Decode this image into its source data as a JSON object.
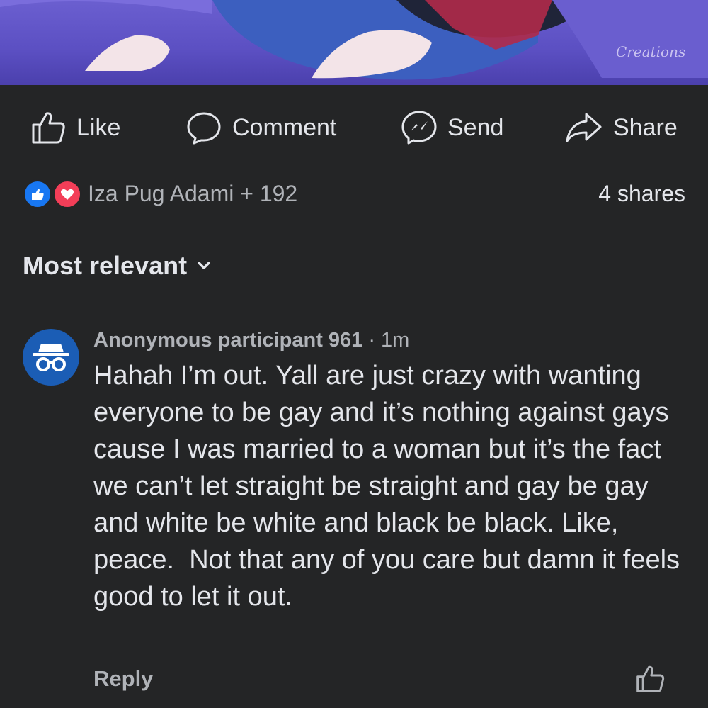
{
  "media": {
    "watermark": "Creations"
  },
  "actions": {
    "like": "Like",
    "comment": "Comment",
    "send": "Send",
    "share": "Share"
  },
  "reactions": {
    "names": "Iza Pug Adami + 192",
    "shares": "4 shares"
  },
  "sort": {
    "label": "Most relevant"
  },
  "comment": {
    "author": "Anonymous participant 961",
    "time": "1m",
    "text": "Hahah I’m out. Yall are just crazy with wanting everyone to be gay and it’s nothing against gays cause I was married to a woman but it’s the fact we can’t let straight be straight and gay be gay and white be white and black be black. Like, peace.  Not that any of you care but damn it feels good to let it out.",
    "reply": "Reply"
  },
  "colors": {
    "background": "#242526",
    "text": "#e4e6eb",
    "secondary": "#b0b3b8",
    "like_blue": "#1877f2",
    "love_red": "#f33e58",
    "avatar_blue": "#1b5db5"
  }
}
